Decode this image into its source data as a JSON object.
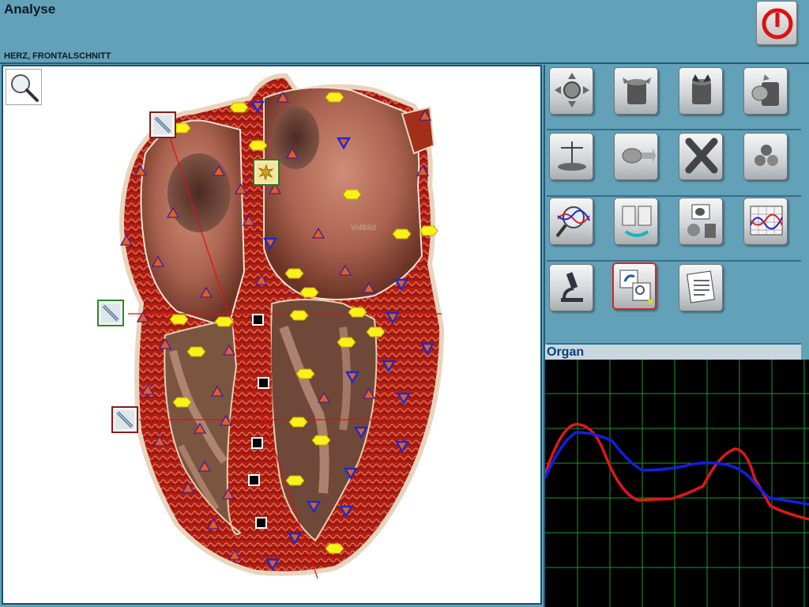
{
  "window": {
    "title": "Analyse",
    "subtitle": "HERZ, FRONTALSCHNITT"
  },
  "toolbar": {
    "power_icon": "power-icon"
  },
  "canvas": {
    "zoom_icon": "magnifier-icon",
    "watermark": "Vollbild"
  },
  "panel": {
    "buttons": [
      "focus-target-icon",
      "container-out-icon",
      "container-in-icon",
      "organ-container-icon",
      "scale-icon",
      "organ-arrow-icon",
      "clear-x-icon",
      "spheres-icon",
      "spectrum-magnify-icon",
      "book-cycle-icon",
      "organ-cycle-icon",
      "wave-graph-icon",
      "microscope-icon",
      "compare-icon",
      "report-icon"
    ],
    "selected_button": "compare-icon"
  },
  "graph": {
    "label": "Organ",
    "colors": {
      "grid": "#1a9a2a",
      "series_red": "#e01818",
      "series_blue": "#1020e0",
      "background": "#000000"
    }
  },
  "markers": {
    "colors": {
      "triangle_up": "#e0601a",
      "triangle_down": "#1a2ad0",
      "hexagon": "#f6f21a",
      "square": "#000000",
      "needle_frame_red": "#8b1a1a",
      "needle_frame_green": "#2a8a2a"
    }
  }
}
